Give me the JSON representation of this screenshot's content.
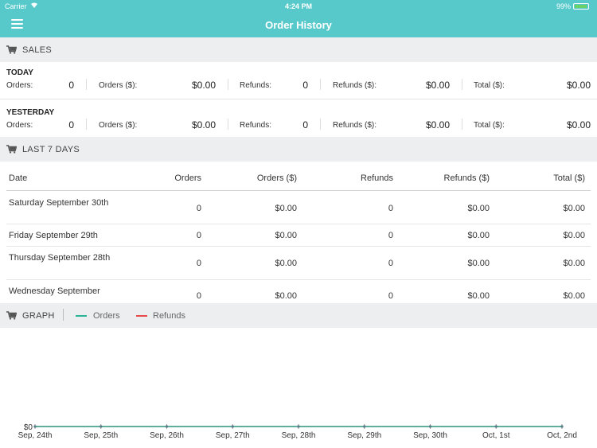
{
  "status_bar": {
    "carrier": "Carrier",
    "time": "4:24 PM",
    "battery": "99%"
  },
  "nav": {
    "title": "Order History"
  },
  "sales_header": "SALES",
  "today": {
    "title": "TODAY",
    "orders_label": "Orders:",
    "orders": "0",
    "orders_amount_label": "Orders ($):",
    "orders_amount": "$0.00",
    "refunds_label": "Refunds:",
    "refunds": "0",
    "refunds_amount_label": "Refunds ($):",
    "refunds_amount": "$0.00",
    "total_label": "Total ($):",
    "total": "$0.00"
  },
  "yesterday": {
    "title": "YESTERDAY",
    "orders_label": "Orders:",
    "orders": "0",
    "orders_amount_label": "Orders ($):",
    "orders_amount": "$0.00",
    "refunds_label": "Refunds:",
    "refunds": "0",
    "refunds_amount_label": "Refunds ($):",
    "refunds_amount": "$0.00",
    "total_label": "Total ($):",
    "total": "$0.00"
  },
  "last7_header": "LAST 7 DAYS",
  "table": {
    "columns": [
      "Date",
      "Orders",
      "Orders ($)",
      "Refunds",
      "Refunds ($)",
      "Total ($)"
    ],
    "rows": [
      {
        "date": "Saturday September 30th",
        "orders": "0",
        "orders_amount": "$0.00",
        "refunds": "0",
        "refunds_amount": "$0.00",
        "total": "$0.00"
      },
      {
        "date": "Friday September 29th",
        "orders": "0",
        "orders_amount": "$0.00",
        "refunds": "0",
        "refunds_amount": "$0.00",
        "total": "$0.00"
      },
      {
        "date": "Thursday September 28th",
        "orders": "0",
        "orders_amount": "$0.00",
        "refunds": "0",
        "refunds_amount": "$0.00",
        "total": "$0.00"
      },
      {
        "date": "Wednesday September",
        "orders": "0",
        "orders_amount": "$0.00",
        "refunds": "0",
        "refunds_amount": "$0.00",
        "total": "$0.00"
      }
    ]
  },
  "graph_header": "GRAPH",
  "legend": {
    "orders_label": "Orders",
    "orders_color": "#2bb39a",
    "refunds_label": "Refunds",
    "refunds_color": "#e84a4a"
  },
  "icons": {
    "menu": "hamburger-icon",
    "cart": "cart-icon",
    "wifi": "wifi-icon",
    "battery": "battery-icon"
  },
  "chart_data": {
    "type": "line",
    "x": [
      "Sep, 24th",
      "Sep, 25th",
      "Sep, 26th",
      "Sep, 27th",
      "Sep, 28th",
      "Sep, 29th",
      "Sep, 30th",
      "Oct, 1st",
      "Oct, 2nd"
    ],
    "series": [
      {
        "name": "Orders",
        "values": [
          0,
          0,
          0,
          0,
          0,
          0,
          0,
          0,
          0
        ],
        "color": "#2bb39a"
      },
      {
        "name": "Refunds",
        "values": [
          0,
          0,
          0,
          0,
          0,
          0,
          0,
          0,
          0
        ],
        "color": "#e84a4a"
      }
    ],
    "y_tick_labels": [
      "$0"
    ],
    "ylim": [
      0,
      1
    ],
    "grid": false
  }
}
